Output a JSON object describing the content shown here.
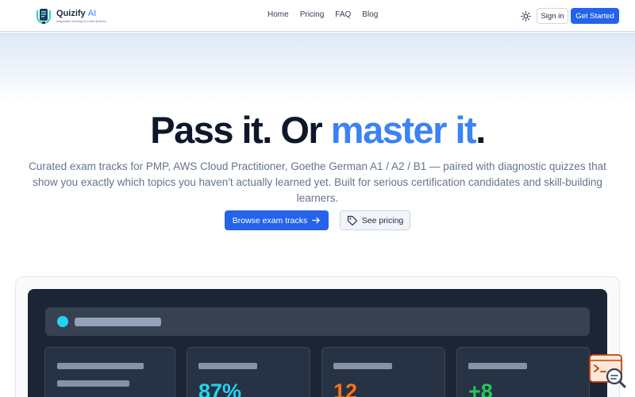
{
  "brand": {
    "name": "Quizify",
    "suffix": "AI",
    "tagline": "diagnostic learning & exam quizzes"
  },
  "nav": {
    "items": [
      {
        "label": "Home"
      },
      {
        "label": "Pricing"
      },
      {
        "label": "FAQ"
      },
      {
        "label": "Blog"
      }
    ],
    "theme_icon": "sun-icon",
    "signin_label": "Sign in",
    "get_started_label": "Get Started"
  },
  "hero": {
    "title_part1": "Pass it. Or ",
    "title_accent": "master it",
    "title_end": ".",
    "subtitle": "Curated exam tracks for PMP, AWS Cloud Practitioner, Goethe German A1 / A2 / B1 — paired with diagnostic quizzes that show you exactly which topics you haven't actually learned yet. Built for serious certification candidates and skill-building learners.",
    "primary_cta": "Browse exam tracks",
    "primary_cta_icon": "arrow-right-icon",
    "secondary_cta": "See pricing",
    "secondary_cta_icon": "tag-icon"
  },
  "preview": {
    "stats": [
      {
        "value": "87%",
        "color": "#22d3ee"
      },
      {
        "value": "12",
        "color": "#f97316"
      },
      {
        "value": "+8",
        "color": "#22c55e"
      }
    ]
  },
  "colors": {
    "accent": "#3b82f6",
    "primary_button": "#2563eb"
  }
}
